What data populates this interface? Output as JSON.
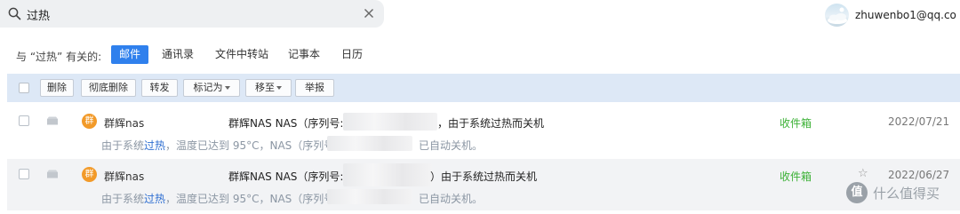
{
  "search": {
    "query": "过热"
  },
  "user": {
    "account": "zhuwenbo1@qq.co"
  },
  "filters": {
    "label": "与 “过热” 有关的:",
    "tabs": [
      {
        "label": "邮件",
        "active": true
      },
      {
        "label": "通讯录",
        "active": false
      },
      {
        "label": "文件中转站",
        "active": false
      },
      {
        "label": "记事本",
        "active": false
      },
      {
        "label": "日历",
        "active": false
      }
    ]
  },
  "toolbar": {
    "delete": "删除",
    "delete_permanent": "彻底删除",
    "forward": "转发",
    "mark_as": "标记为",
    "move_to": "移至",
    "report": "举报"
  },
  "emails": [
    {
      "avatar": "群",
      "sender": "群辉nas",
      "subject_prefix": "群辉NAS NAS（序列号:",
      "subject_mid": "，由于系统",
      "subject_hl": "过热",
      "subject_suffix": "而关机",
      "preview_prefix": "由于系统",
      "preview_hl": "过热",
      "preview_suffix": "，温度已达到 95°C，NAS（序列号:",
      "preview_end": "已自动关机。",
      "folder": "收件箱",
      "date": "2022/07/21"
    },
    {
      "avatar": "群",
      "sender": "群辉nas",
      "subject_prefix": "群辉NAS NAS（序列号:",
      "subject_mid": "）由于系统",
      "subject_hl": "过热",
      "subject_suffix": "而关机",
      "preview_prefix": "由于系统",
      "preview_hl": "过热",
      "preview_suffix": "，温度已达到 95°C，NAS（序列号:",
      "preview_end": "已自动关机。",
      "folder": "收件箱",
      "star": "☆",
      "date": "2022/06/27"
    }
  ],
  "watermark": {
    "logo": "值",
    "text": "什么值得买"
  }
}
